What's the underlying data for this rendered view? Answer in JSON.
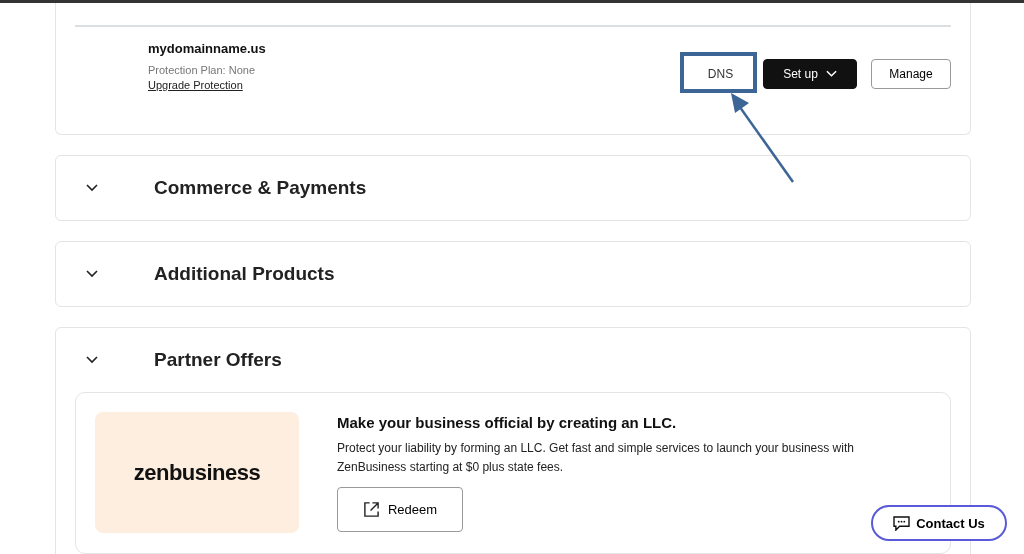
{
  "domain_card": {
    "domain": "mydomainname.us",
    "protection": "Protection Plan: None",
    "upgrade_link": "Upgrade Protection",
    "buttons": [
      {
        "label": "DNS",
        "kind": "outline-plain",
        "highlighted": true
      },
      {
        "label": "Set up",
        "kind": "dark-dropdown",
        "highlighted": false
      },
      {
        "label": "Manage",
        "kind": "outline",
        "highlighted": false
      }
    ]
  },
  "sections": [
    {
      "title": "Commerce & Payments",
      "expanded": false
    },
    {
      "title": "Additional Products",
      "expanded": false
    },
    {
      "title": "Partner Offers",
      "expanded": true,
      "offer": {
        "logo": "zenbusiness",
        "title": "Make your business official by creating an LLC.",
        "description": "Protect your liability by forming an LLC. Get fast and simple services to launch your business with ZenBusiness starting at $0 plus state fees.",
        "button": "Redeem"
      }
    }
  ],
  "contact_button": "Contact Us"
}
